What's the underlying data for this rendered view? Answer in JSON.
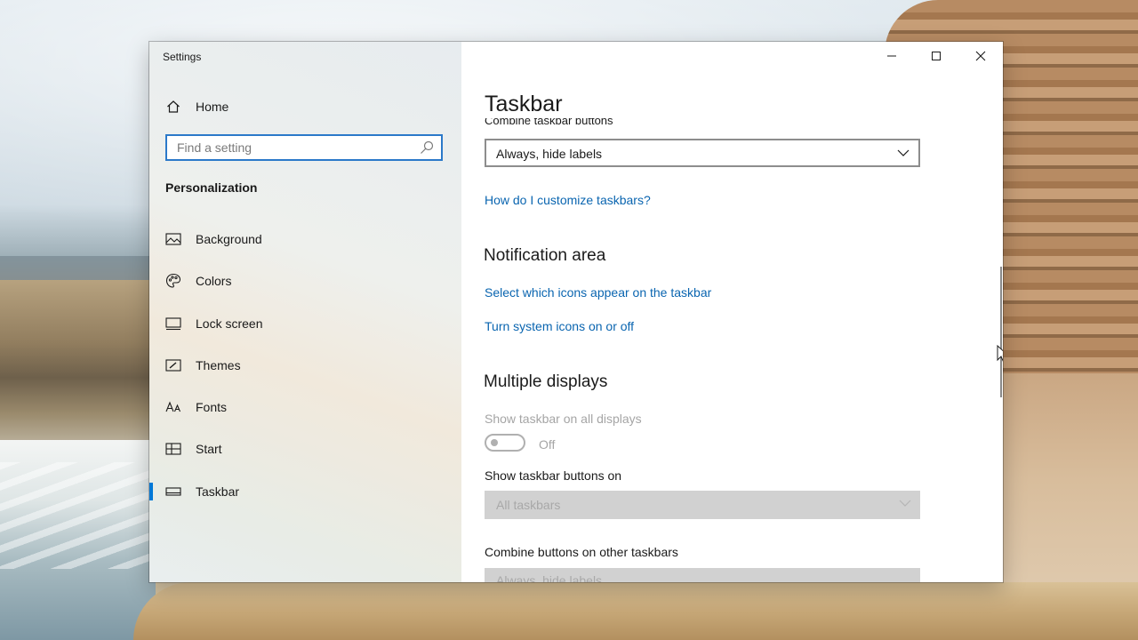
{
  "window": {
    "title": "Settings",
    "controls": {
      "minimize": "minimize",
      "maximize": "maximize",
      "close": "close"
    }
  },
  "nav": {
    "home": {
      "label": "Home",
      "icon": "home-icon"
    },
    "search": {
      "placeholder": "Find a setting",
      "icon": "search-icon"
    },
    "section": "Personalization",
    "items": [
      {
        "label": "Background",
        "icon": "picture-icon",
        "selected": false
      },
      {
        "label": "Colors",
        "icon": "palette-icon",
        "selected": false
      },
      {
        "label": "Lock screen",
        "icon": "monitor-lock-icon",
        "selected": false
      },
      {
        "label": "Themes",
        "icon": "brush-icon",
        "selected": false
      },
      {
        "label": "Fonts",
        "icon": "font-icon",
        "selected": false
      },
      {
        "label": "Start",
        "icon": "start-grid-icon",
        "selected": false
      },
      {
        "label": "Taskbar",
        "icon": "taskbar-icon",
        "selected": true
      }
    ]
  },
  "content": {
    "title": "Taskbar",
    "clipped_label": "Combine taskbar buttons",
    "combine_dropdown": {
      "value": "Always, hide labels"
    },
    "help_link": "How do I customize taskbars?",
    "notification": {
      "heading": "Notification area",
      "links": [
        "Select which icons appear on the taskbar",
        "Turn system icons on or off"
      ]
    },
    "multiple_displays": {
      "heading": "Multiple displays",
      "show_all_label": "Show taskbar on all displays",
      "toggle_state": "Off",
      "buttons_on_label": "Show taskbar buttons on",
      "buttons_on_value": "All taskbars",
      "combine_other_label": "Combine buttons on other taskbars",
      "combine_other_value": "Always, hide labels"
    }
  },
  "colors": {
    "accent": "#0078d7",
    "link": "#0a65b0",
    "disabled": "#a5a5a5"
  }
}
